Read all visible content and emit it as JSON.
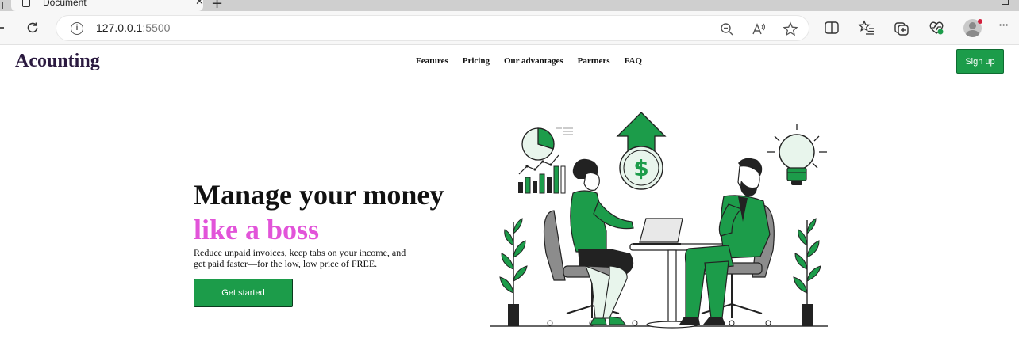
{
  "browser": {
    "tab_title": "Document",
    "tab_close": "✕",
    "new_tab": "+",
    "url_host": "127.0.0.1",
    "url_port": ":5500",
    "info_glyph": "i",
    "more_glyph": "···"
  },
  "header": {
    "logo": "Acounting",
    "nav": [
      "Features",
      "Pricing",
      "Our advantages",
      "Partners",
      "FAQ"
    ],
    "signup_label": "Sign up"
  },
  "hero": {
    "title": "Manage your money",
    "accent": "like a boss",
    "description": "Reduce unpaid invoices, keep tabs on your income, and get paid faster—for the low, low price of FREE.",
    "cta_label": "Get started"
  },
  "illustration": {
    "currency_symbol": "$"
  },
  "colors": {
    "brand_green": "#1c9c4a",
    "accent_pink": "#e254d9",
    "logo_color": "#2b1a40"
  },
  "icons": [
    "document-icon",
    "reload-icon",
    "info-icon",
    "zoom-out-icon",
    "read-aloud-icon",
    "favorite-star-icon",
    "split-screen-icon",
    "favorites-icon",
    "collections-icon",
    "health-icon",
    "profile-avatar-icon",
    "more-icon"
  ]
}
